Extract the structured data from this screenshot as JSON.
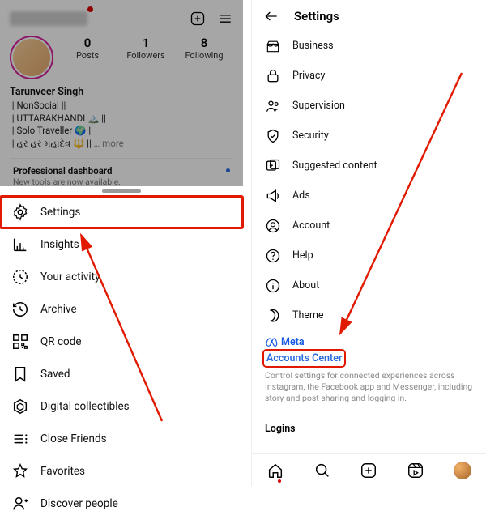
{
  "left_pane": {
    "profile": {
      "name": "Tarunveer Singh",
      "bio_lines": [
        "|| NonSocial ||",
        "|| UTTARAKHANDI 🏔️ ||",
        "|| Solo Traveller 🌍 ||",
        "|| હર હર મહાદેવ 🔱 ||"
      ],
      "more": "… more",
      "stats": {
        "posts": {
          "count": "0",
          "label": "Posts"
        },
        "followers": {
          "count": "1",
          "label": "Followers"
        },
        "following": {
          "count": "8",
          "label": "Following"
        }
      },
      "dashboard": {
        "title": "Professional dashboard",
        "subtitle": "New tools are now available."
      }
    },
    "menu": [
      {
        "icon": "settings-icon",
        "label": "Settings"
      },
      {
        "icon": "insights-icon",
        "label": "Insights"
      },
      {
        "icon": "activity-icon",
        "label": "Your activity"
      },
      {
        "icon": "archive-icon",
        "label": "Archive"
      },
      {
        "icon": "qr-icon",
        "label": "QR code"
      },
      {
        "icon": "saved-icon",
        "label": "Saved"
      },
      {
        "icon": "collectibles-icon",
        "label": "Digital collectibles"
      },
      {
        "icon": "close-friends-icon",
        "label": "Close Friends"
      },
      {
        "icon": "favorites-icon",
        "label": "Favorites"
      },
      {
        "icon": "discover-icon",
        "label": "Discover people"
      }
    ]
  },
  "right_pane": {
    "header_title": "Settings",
    "items": [
      {
        "icon": "business-icon",
        "label": "Business"
      },
      {
        "icon": "privacy-icon",
        "label": "Privacy"
      },
      {
        "icon": "supervision-icon",
        "label": "Supervision"
      },
      {
        "icon": "security-icon",
        "label": "Security"
      },
      {
        "icon": "suggested-icon",
        "label": "Suggested content"
      },
      {
        "icon": "ads-icon",
        "label": "Ads"
      },
      {
        "icon": "account-icon",
        "label": "Account"
      },
      {
        "icon": "help-icon",
        "label": "Help"
      },
      {
        "icon": "about-icon",
        "label": "About"
      },
      {
        "icon": "theme-icon",
        "label": "Theme"
      }
    ],
    "meta_brand": "Meta",
    "accounts_center_label": "Accounts Center",
    "accounts_center_desc": "Control settings for connected experiences across Instagram, the Facebook app and Messenger, including story and post sharing and logging in.",
    "logins_label": "Logins"
  },
  "annotations": {
    "highlight_left_index": 0,
    "arrow_color": "#e11900"
  }
}
